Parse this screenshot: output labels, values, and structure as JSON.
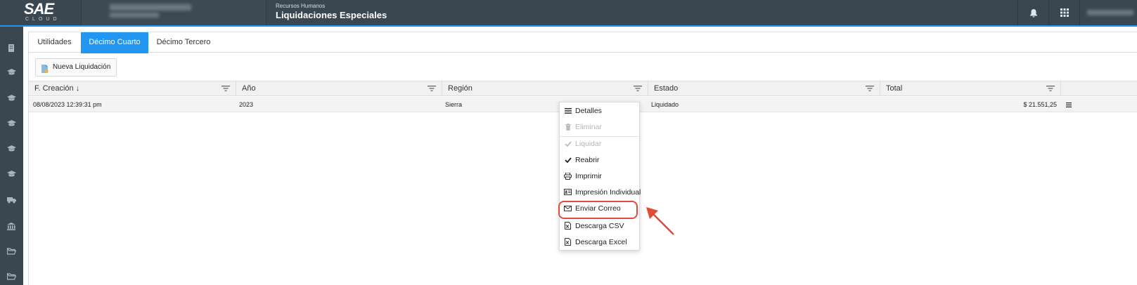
{
  "app": {
    "logo_text": "SAE",
    "logo_sub": "CLOUD",
    "module": "Recursos Humanos",
    "title": "Liquidaciones Especiales"
  },
  "tabs": [
    {
      "label": "Utilidades",
      "active": false
    },
    {
      "label": "Décimo Cuarto",
      "active": true
    },
    {
      "label": "Décimo Tercero",
      "active": false
    }
  ],
  "toolbar": {
    "new_label": "Nueva Liquidación"
  },
  "grid": {
    "columns": [
      "F. Creación ↓",
      "Año",
      "Región",
      "Estado",
      "Total"
    ],
    "rows": [
      {
        "fecha": "08/08/2023 12:39:31 pm",
        "anio": "2023",
        "region": "Sierra",
        "estado": "Liquidado",
        "total": "$ 21.551,25"
      }
    ]
  },
  "context_menu": {
    "items": [
      {
        "label": "Detalles",
        "icon": "list-icon",
        "disabled": false
      },
      {
        "label": "Eliminar",
        "icon": "trash-icon",
        "disabled": true
      },
      {
        "label": "Liquidar",
        "icon": "check-icon",
        "disabled": true
      },
      {
        "label": "Reabrir",
        "icon": "check-icon",
        "disabled": false
      },
      {
        "label": "Imprimir",
        "icon": "printer-icon",
        "disabled": false
      },
      {
        "label": "Impresión Individual",
        "icon": "id-card-icon",
        "disabled": false
      },
      {
        "label": "Enviar Correo",
        "icon": "envelope-icon",
        "disabled": false
      },
      {
        "label": "Descarga CSV",
        "icon": "csv-file-icon",
        "disabled": false
      },
      {
        "label": "Descarga Excel",
        "icon": "excel-file-icon",
        "disabled": false
      }
    ]
  },
  "colors": {
    "topbar": "#3a4750",
    "accent": "#2196f3",
    "highlight": "#e04b3a"
  }
}
